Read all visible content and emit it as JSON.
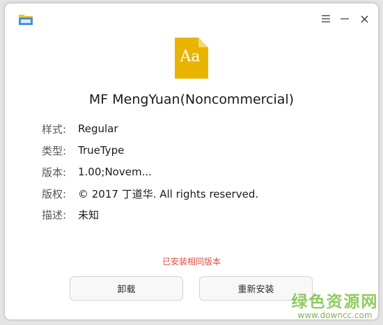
{
  "window": {
    "app_icon": "font-installer-icon",
    "controls": {
      "menu_icon": "hamburger-menu-icon",
      "minimize_icon": "minimize-icon",
      "close_icon": "close-icon"
    }
  },
  "font": {
    "icon_glyph": "Aa",
    "icon_color": "#e8b400",
    "name": "MF MengYuan(Noncommercial)"
  },
  "info": [
    {
      "label": "样式:",
      "value": "Regular"
    },
    {
      "label": "类型:",
      "value": "TrueType"
    },
    {
      "label": "版本:",
      "value": "1.00;Novem..."
    },
    {
      "label": "版权:",
      "value": "© 2017 丁道华. All rights reserved."
    },
    {
      "label": "描述:",
      "value": "未知"
    }
  ],
  "status_text": "已安装相同版本",
  "status_color": "#e04a3a",
  "buttons": {
    "uninstall": "卸载",
    "reinstall": "重新安装"
  },
  "watermark": {
    "main": "绿色资源网",
    "sub": "www.downcc.com"
  }
}
